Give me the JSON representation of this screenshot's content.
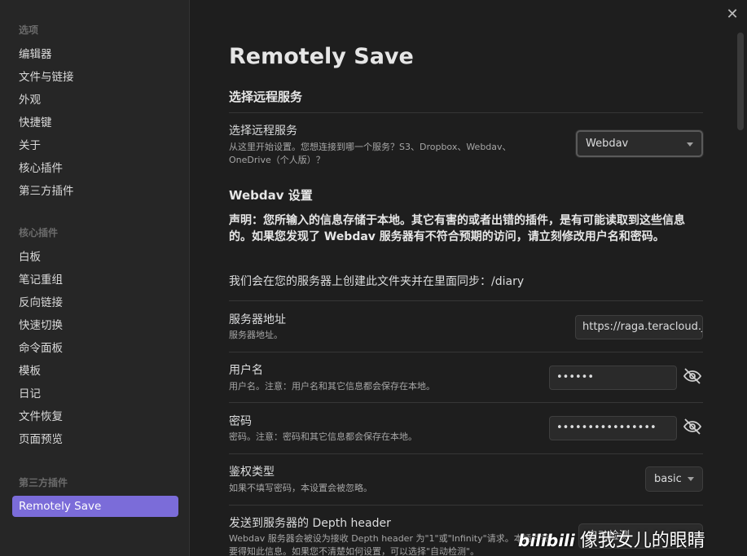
{
  "sidebar": {
    "options_header": "选项",
    "options": [
      "编辑器",
      "文件与链接",
      "外观",
      "快捷键",
      "关于",
      "核心插件",
      "第三方插件"
    ],
    "core_header": "核心插件",
    "core": [
      "白板",
      "笔记重组",
      "反向链接",
      "快速切换",
      "命令面板",
      "模板",
      "日记",
      "文件恢复",
      "页面预览"
    ],
    "community_header": "第三方插件",
    "community": [
      "Remotely Save"
    ]
  },
  "main": {
    "title": "Remotely Save",
    "service_section": "选择远程服务",
    "service": {
      "name": "选择远程服务",
      "desc_line1": "从这里开始设置。您想连接到哪一个服务？S3、Dropbox、Webdav、",
      "desc_line2": "OneDrive（个人版）？",
      "value": "Webdav"
    },
    "webdav_section": "Webdav 设置",
    "warning": "声明：您所输入的信息存储于本地。其它有害的或者出错的插件，是有可能读取到这些信息的。如果您发现了 Webdav 服务器有不符合预期的访问，请立刻修改用户名和密码。",
    "info": "我们会在您的服务器上创建此文件夹并在里面同步：/diary",
    "server": {
      "name": "服务器地址",
      "desc": "服务器地址。",
      "value": "https://raga.teracloud.jp/"
    },
    "username": {
      "name": "用户名",
      "desc": "用户名。注意：用户名和其它信息都会保存在本地。",
      "value": "••••••"
    },
    "password": {
      "name": "密码",
      "desc": "密码。注意：密码和其它信息都会保存在本地。",
      "value": "••••••••••••••••"
    },
    "auth": {
      "name": "鉴权类型",
      "desc": "如果不填写密码，本设置会被忽略。",
      "value": "basic"
    },
    "depth": {
      "name": "发送到服务器的 Depth header",
      "desc_line1": "Webdav 服务器会被设为接收 Depth header 为\"1\"或\"Infinity\"请求。本插件需",
      "desc_line2": "要得知此信息。如果您不清楚如何设置，可以选择\"自动检测\"。",
      "value": "自动检测"
    }
  },
  "watermark": {
    "logo": "bilibili",
    "text": "像我女儿的眼睛"
  },
  "colors": {
    "accent": "#7b6cd9",
    "background": "#1e1e1e",
    "sidebar": "#262626"
  },
  "icons": {
    "close": "close-icon",
    "eye_off": "eye-off-icon",
    "caret": "chevron-down-icon"
  }
}
